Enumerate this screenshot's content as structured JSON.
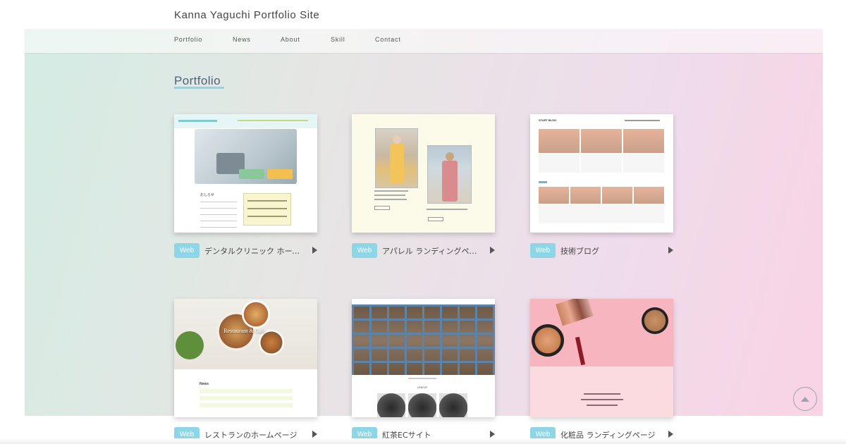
{
  "site": {
    "title": "Kanna Yaguchi Portfolio Site"
  },
  "nav": [
    {
      "label": "Portfolio"
    },
    {
      "label": "News"
    },
    {
      "label": "About"
    },
    {
      "label": "Skill"
    },
    {
      "label": "Contact"
    }
  ],
  "section": {
    "title": "Portfolio"
  },
  "portfolio": [
    {
      "badge": "Web",
      "title": "デンタルクリニック ホームページ"
    },
    {
      "badge": "Web",
      "title": "アパレル ランディングページ"
    },
    {
      "badge": "Web",
      "title": "技術ブログ"
    },
    {
      "badge": "Web",
      "title": "レストランのホームページ"
    },
    {
      "badge": "Web",
      "title": "紅茶ECサイト"
    },
    {
      "badge": "Web",
      "title": "化粧品 ランディングページ"
    }
  ],
  "thumb_text": {
    "dental_news": "おしらせ",
    "blog_logo": "STAFF BLOG",
    "restaurant_title": "Restaurant & Cafe",
    "restaurant_news": "News",
    "tea_lineup": "LINEUP"
  },
  "colors": {
    "accent": "#8dd6e8",
    "band_start": "#d3ece3",
    "band_end": "#f9d3e5"
  },
  "icons": {
    "scroll_top": "chevron-up-icon",
    "caption_arrow": "caret-right-icon"
  }
}
